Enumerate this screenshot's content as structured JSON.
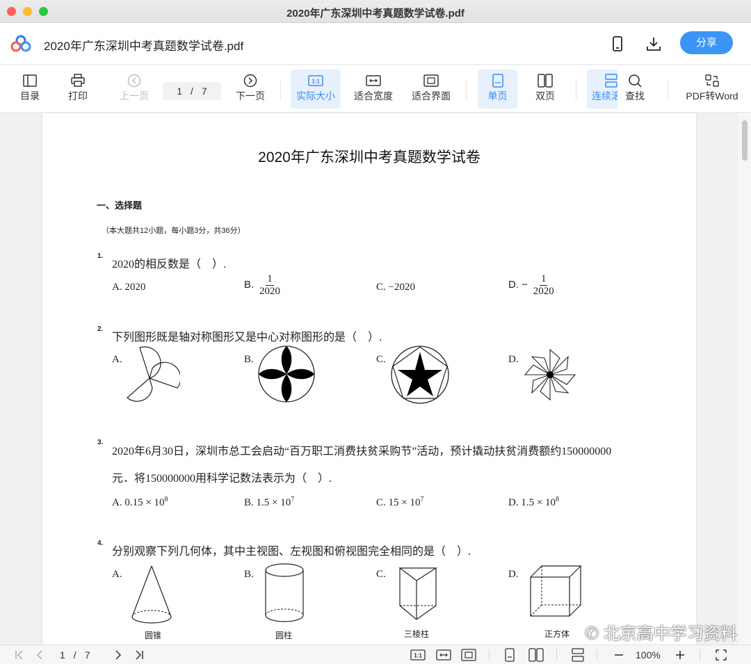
{
  "window": {
    "title": "2020年广东深圳中考真题数学试卷.pdf"
  },
  "header": {
    "doc_name": "2020年广东深圳中考真题数学试卷.pdf",
    "share_label": "分享",
    "icons": [
      "phone-icon",
      "download-icon"
    ]
  },
  "toolbar": {
    "toc": "目录",
    "print": "打印",
    "prev": "上一页",
    "current_page": "1",
    "page_sep": "/",
    "total_pages": "7",
    "next": "下一页",
    "actual_size": "实际大小",
    "fit_width": "适合宽度",
    "fit_screen": "适合界面",
    "single": "单页",
    "double": "双页",
    "continuous": "连续滚动",
    "find": "查找",
    "to_word": "PDF转Word"
  },
  "document": {
    "title": "2020年广东深圳中考真题数学试卷",
    "section": "一、选择题",
    "section_note": "（本大题共12小题，每小题3分，共36分）",
    "questions": [
      {
        "num": "1.",
        "text": "2020的相反数是（　）.",
        "options": {
          "a": "A. 2020",
          "b_letter": "B.",
          "b_num": "1",
          "b_den": "2020",
          "c": "C. −2020",
          "d_letter": "D. −",
          "d_num": "1",
          "d_den": "2020"
        }
      },
      {
        "num": "2.",
        "text": "下列图形既是轴对称图形又是中心对称图形的是（　）.",
        "options": {
          "a": "A.",
          "b": "B.",
          "c": "C.",
          "d": "D."
        }
      },
      {
        "num": "3.",
        "text": "2020年6月30日，深圳市总工会启动“百万职工消费扶贫采购节”活动，预计撬动扶贫消费额约150000000",
        "text2": "元．将150000000用科学记数法表示为（　）.",
        "options": {
          "a": "A. 0.15 × 10",
          "a_exp": "8",
          "b": "B. 1.5 × 10",
          "b_exp": "7",
          "c": "C. 15 × 10",
          "c_exp": "7",
          "d": "D. 1.5 × 10",
          "d_exp": "8"
        }
      },
      {
        "num": "4.",
        "text": "分别观察下列几何体，其中主视图、左视图和俯视图完全相同的是（　）.",
        "options": {
          "a": "A.",
          "b": "B.",
          "c": "C.",
          "d": "D."
        },
        "captions": {
          "a": "圆锥",
          "b": "圆柱",
          "c": "三棱柱",
          "d": "正方体"
        }
      }
    ],
    "watermark": "北京高中学习资料"
  },
  "statusbar": {
    "current_page": "1",
    "page_sep": "/",
    "total_pages": "7",
    "zoom": "100%"
  }
}
